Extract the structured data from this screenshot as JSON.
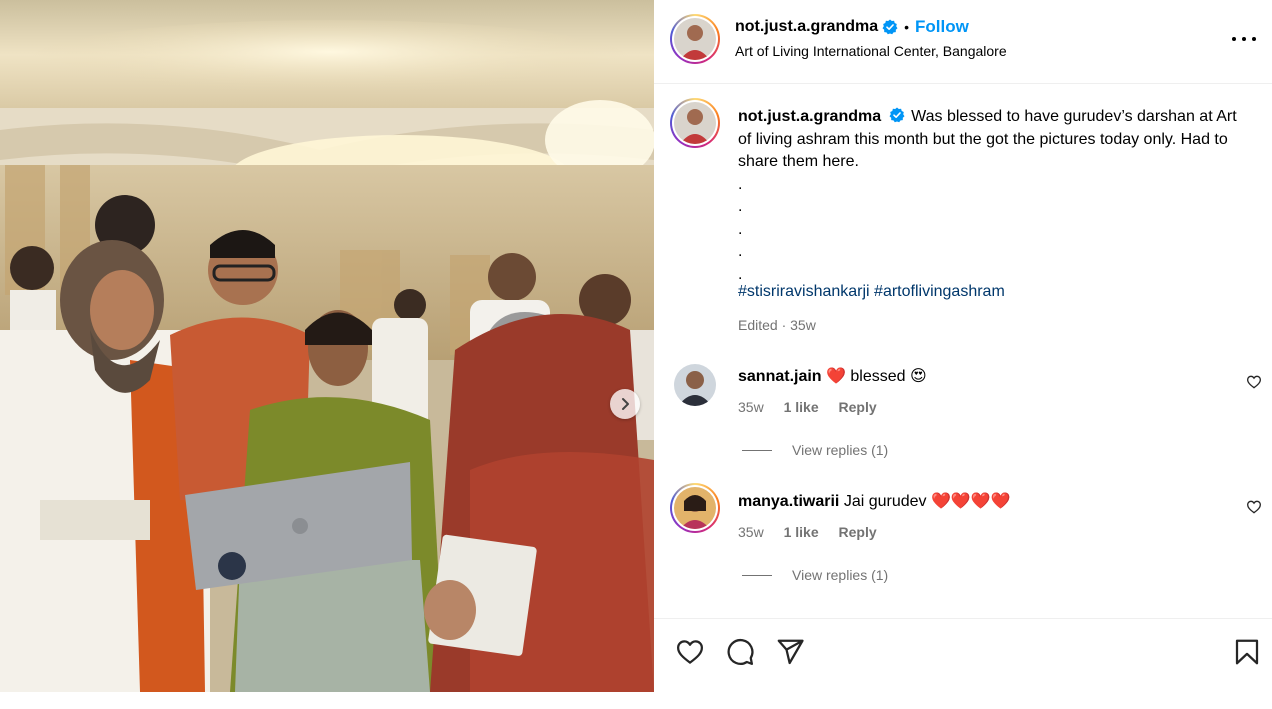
{
  "post": {
    "author": "not.just.a.grandma",
    "verified": true,
    "follow_label": "Follow",
    "separator": "•",
    "location": "Art of Living International Center, Bangalore",
    "more_icon": "more-horizontal-icon"
  },
  "caption": {
    "author": "not.just.a.grandma",
    "text": "Was blessed to have gurudev’s darshan at Art of living ashram this month but the got the pictures today only. Had to share them here.",
    "dots": [
      ".",
      ".",
      ".",
      ".",
      "."
    ],
    "hashtags": [
      "#stisriravishankarji",
      "#artoflivingashram"
    ],
    "edited": "Edited · 35w"
  },
  "comments": [
    {
      "user": "sannat.jain",
      "text": "blessed",
      "prefix_emoji": "❤️",
      "suffix_emoji": "😍",
      "age": "35w",
      "likes": "1 like",
      "reply_label": "Reply",
      "view_replies": "View replies (1)"
    },
    {
      "user": "manya.tiwarii",
      "text": "Jai gurudev",
      "suffix_emoji": "❤️❤️❤️❤️",
      "age": "35w",
      "likes": "1 like",
      "reply_label": "Reply",
      "view_replies": "View replies (1)"
    }
  ],
  "actions": [
    "like-icon",
    "comment-icon",
    "share-icon",
    "save-icon"
  ],
  "colors": {
    "follow": "#0095f6",
    "hashtag": "#00376b",
    "verified": "#0095f6",
    "heart_emoji": "#e0245e",
    "muted": "#737373"
  }
}
